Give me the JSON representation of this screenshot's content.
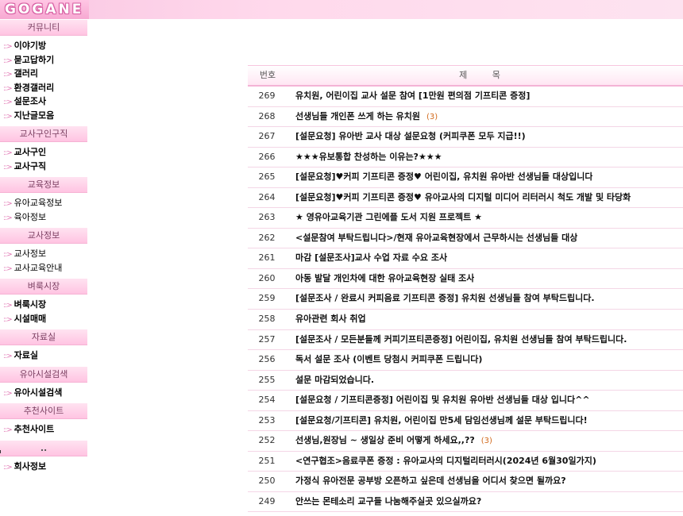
{
  "logo": {
    "text": "GOGANE"
  },
  "sidebar": {
    "sections": [
      {
        "title": "커뮤니티",
        "items": [
          "이야기방",
          "묻고답하기",
          "갤러리",
          "환경갤러리",
          "설문조사",
          "지난글모음"
        ]
      },
      {
        "title": "교사구인구직",
        "items": [
          "교사구인",
          "교사구직"
        ]
      },
      {
        "title": "교육정보",
        "items": [
          "유아교육정보",
          "육아정보"
        ]
      },
      {
        "title": "교사정보",
        "items": [
          "교사정보",
          "교사교육안내"
        ]
      },
      {
        "title": "벼룩시장",
        "items": [
          "벼룩시장",
          "시설매매"
        ]
      },
      {
        "title": "자료실",
        "items": [
          "자료실"
        ]
      },
      {
        "title": "유아시설검색",
        "items": [
          "유아시설검색"
        ]
      },
      {
        "title": "추천사이트",
        "items": [
          "추천사이트"
        ]
      },
      {
        "title": "..",
        "items": [
          "회사정보"
        ]
      }
    ]
  },
  "board": {
    "header": {
      "num": "번호",
      "title": "제 목"
    },
    "rows": [
      {
        "num": "269",
        "title": "유치원, 어린이집 교사 설문 참여 [1만원 편의점 기프티콘 증정]",
        "comments": ""
      },
      {
        "num": "268",
        "title": "선생님들 개인폰 쓰게 하는 유치원",
        "comments": "(3)"
      },
      {
        "num": "267",
        "title": "[설문요청] 유아반 교사 대상 설문요청 (커피쿠폰 모두 지급!!)",
        "comments": ""
      },
      {
        "num": "266",
        "title": "★★★유보통합 찬성하는 이유는?★★★",
        "comments": ""
      },
      {
        "num": "265",
        "title": "[설문요청]♥커피 기프티콘 증정♥ 어린이집, 유치원 유아반 선생님들 대상입니다",
        "comments": ""
      },
      {
        "num": "264",
        "title": "[설문요청]♥커피 기프티콘 증정♥ 유아교사의 디지털 미디어 리터러시 척도 개발 및 타당화",
        "comments": ""
      },
      {
        "num": "263",
        "title": "★ 영유아교육기관 그린에플 도서 지원 프로젝트 ★",
        "comments": ""
      },
      {
        "num": "262",
        "title": "<설문참여 부탁드립니다>/현재 유아교육현장에서 근무하시는 선생님들 대상",
        "comments": ""
      },
      {
        "num": "261",
        "title": "마감 [설문조사]교사 수업 자료 수요 조사",
        "comments": ""
      },
      {
        "num": "260",
        "title": "아동 발달 개인차에 대한 유아교육현장 실태 조사",
        "comments": ""
      },
      {
        "num": "259",
        "title": "[설문조사 / 완료시 커피음료 기프티콘 증정] 유치원 선생님들 참여 부탁드립니다.",
        "comments": ""
      },
      {
        "num": "258",
        "title": "유아관련 회사 취업",
        "comments": ""
      },
      {
        "num": "257",
        "title": "[설문조사 / 모든분들께 커피기프티콘증정] 어린이집, 유치원 선생님들 참여 부탁드립니다.",
        "comments": ""
      },
      {
        "num": "256",
        "title": "독서 설문 조사 (이벤트 당첨시 커피쿠폰 드립니다)",
        "comments": ""
      },
      {
        "num": "255",
        "title": "설문 마감되었습니다.",
        "comments": ""
      },
      {
        "num": "254",
        "title": "[설문요청 / 기프티콘증정] 어린이집 및 유치원 유아반 선생님들 대상 입니다^^",
        "comments": ""
      },
      {
        "num": "253",
        "title": "[설문요청/기프티콘] 유치원, 어린이집 만5세 담임선생님께 설문 부탁드립니다!",
        "comments": ""
      },
      {
        "num": "252",
        "title": "선생님,원장님 ~ 생일상 준비 어떻게 하세요,,??",
        "comments": "(3)"
      },
      {
        "num": "251",
        "title": "<연구협조>음료쿠폰 증정 : 유아교사의 디지털리터러시(2024년 6월30일가지)",
        "comments": ""
      },
      {
        "num": "250",
        "title": "가정식 유아전문 공부방 오픈하고 싶은데 선생님을 어디서 찾으면 될까요?",
        "comments": ""
      },
      {
        "num": "249",
        "title": "안쓰는 몬테소리 교구들 나눔해주실곳 있으실까요?",
        "comments": ""
      }
    ]
  },
  "colors": {
    "accent": "#f4b3d5",
    "comment": "#d26a1d",
    "arrow": "#e071b0"
  }
}
